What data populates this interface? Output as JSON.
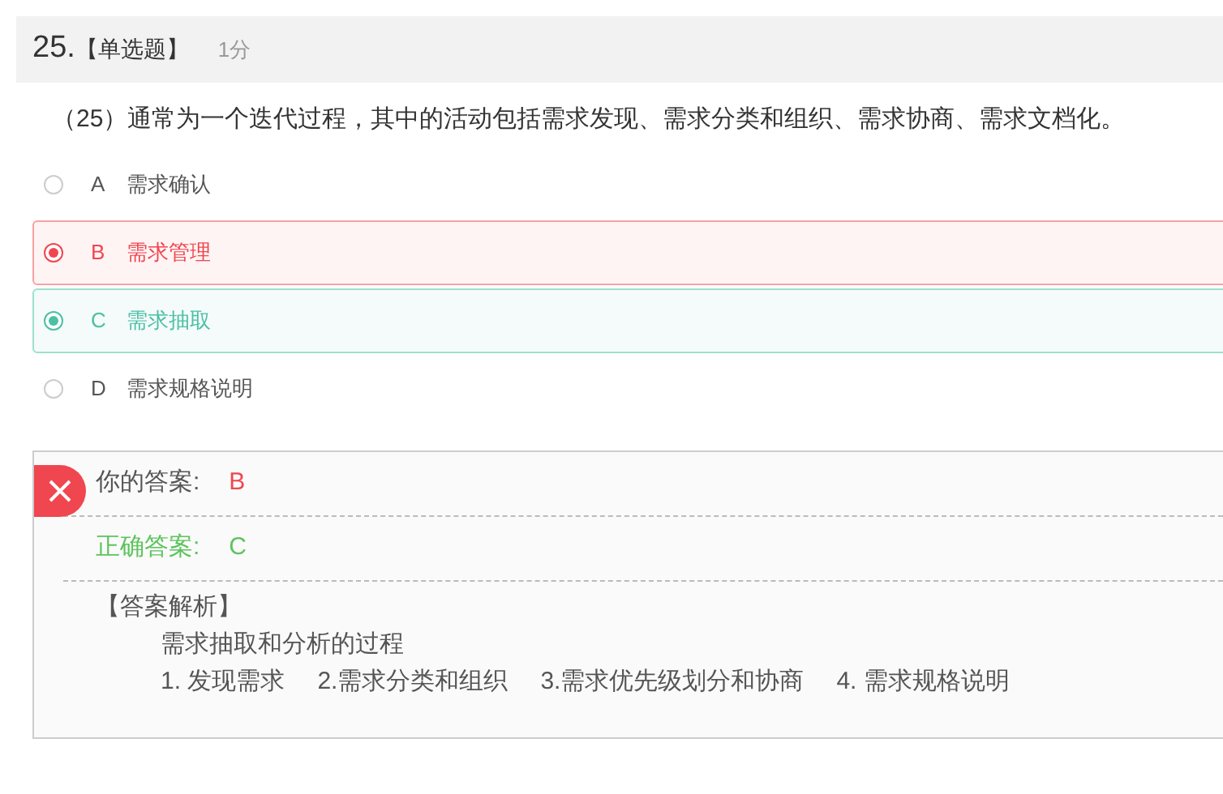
{
  "question": {
    "number": "25.",
    "type": "【单选题】",
    "score": "1分",
    "text": "（25）通常为一个迭代过程，其中的活动包括需求发现、需求分类和组织、需求协商、需求文档化。"
  },
  "options": [
    {
      "letter": "A",
      "text": "需求确认",
      "selected": false,
      "correct": false
    },
    {
      "letter": "B",
      "text": "需求管理",
      "selected": true,
      "correct": false
    },
    {
      "letter": "C",
      "text": "需求抽取",
      "selected": false,
      "correct": true
    },
    {
      "letter": "D",
      "text": "需求规格说明",
      "selected": false,
      "correct": false
    }
  ],
  "result": {
    "is_correct": false,
    "your_label": "你的答案:",
    "your_value": "B",
    "correct_label": "正确答案:",
    "correct_value": "C",
    "analysis_title": "【答案解析】",
    "analysis_text": "需求抽取和分析的过程",
    "analysis_steps": [
      "1. 发现需求",
      "2.需求分类和组织",
      "3.需求优先级划分和协商",
      "4. 需求规格说明"
    ]
  }
}
